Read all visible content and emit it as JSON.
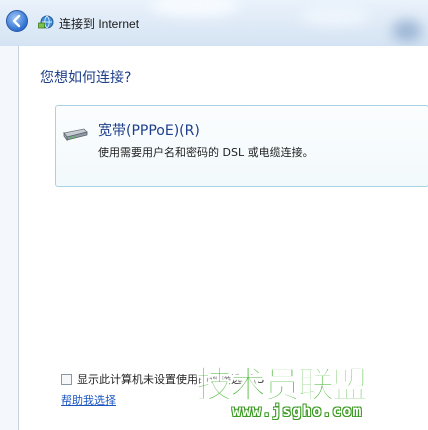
{
  "window": {
    "title": "连接到 Internet"
  },
  "icons": {
    "back": "back-arrow-icon",
    "network": "network-globe-icon",
    "modem": "broadband-modem-icon"
  },
  "main": {
    "heading": "您想如何连接?",
    "options": [
      {
        "title": "宽带(PPPoE)(R)",
        "description": "使用需要用户名和密码的 DSL 或电缆连接。"
      }
    ],
    "checkbox": {
      "label": "显示此计算机未设置使用的连接选项(S",
      "checked": false
    },
    "help_link": "帮助我选择"
  },
  "watermark": {
    "text": "技术员联盟",
    "url": "www.jsgho.com"
  },
  "colors": {
    "accent_text": "#1e3f8a",
    "link": "#1a55c2",
    "option_border": "#a9d3e6",
    "watermark_green": "#3fb22a"
  }
}
